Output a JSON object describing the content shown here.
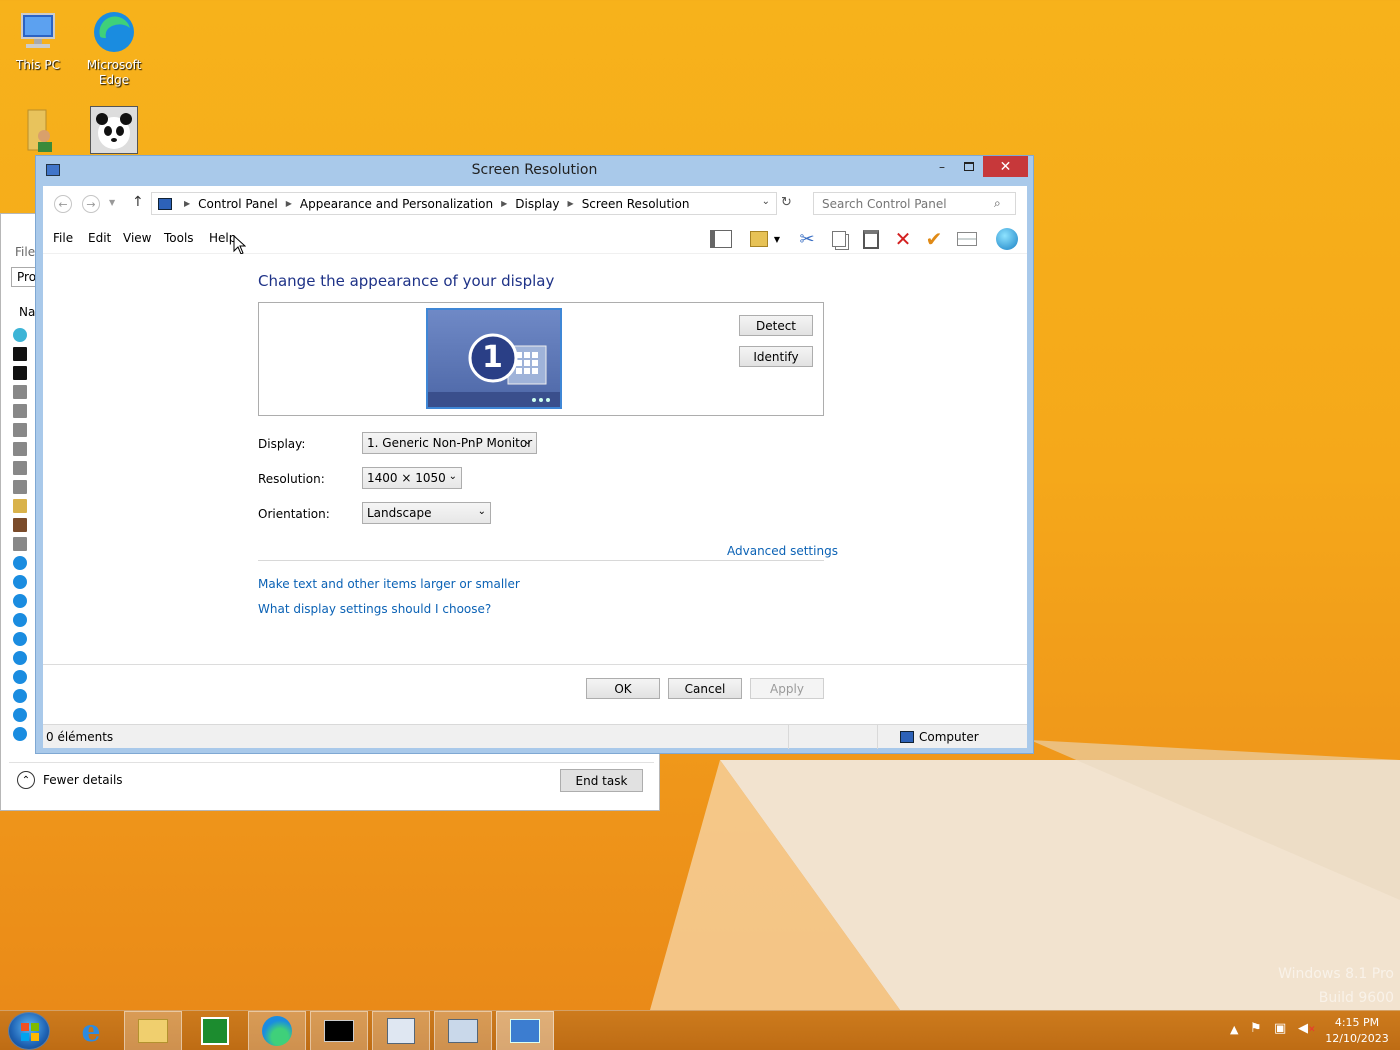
{
  "desktop": {
    "icons": [
      {
        "label_line1": "This PC",
        "label_line2": ""
      },
      {
        "label_line1": "Microsoft",
        "label_line2": "Edge"
      }
    ],
    "watermark_line1": "Windows 8.1 Pro",
    "watermark_line2": "Build 9600"
  },
  "task_manager": {
    "menu_file": "File",
    "tab_proc": "Pro",
    "col_name": "Na",
    "fewer_details": "Fewer details",
    "end_task": "End task"
  },
  "window": {
    "title": "Screen Resolution",
    "breadcrumb": [
      "Control Panel",
      "Appearance and Personalization",
      "Display",
      "Screen Resolution"
    ],
    "search_placeholder": "Search Control Panel",
    "menu": [
      "File",
      "Edit",
      "View",
      "Tools",
      "Help"
    ],
    "heading": "Change the appearance of your display",
    "monitor_number": "1",
    "detect": "Detect",
    "identify": "Identify",
    "display_label": "Display:",
    "display_value": "1. Generic Non-PnP Monitor",
    "resolution_label": "Resolution:",
    "resolution_value": "1400 × 1050",
    "orientation_label": "Orientation:",
    "orientation_value": "Landscape",
    "advanced_settings": "Advanced settings",
    "link_text_size": "Make text and other items larger or smaller",
    "link_choose": "What display settings should I choose?",
    "ok": "OK",
    "cancel": "Cancel",
    "apply": "Apply",
    "status_items": "0 éléments",
    "status_computer": "Computer"
  },
  "taskbar": {
    "time": "4:15 PM",
    "date": "12/10/2023"
  },
  "colors": {
    "accent_link": "#0b62b5",
    "heading": "#1e3287",
    "close_red": "#c7383a",
    "desktop_orange": "#f5a81a"
  }
}
